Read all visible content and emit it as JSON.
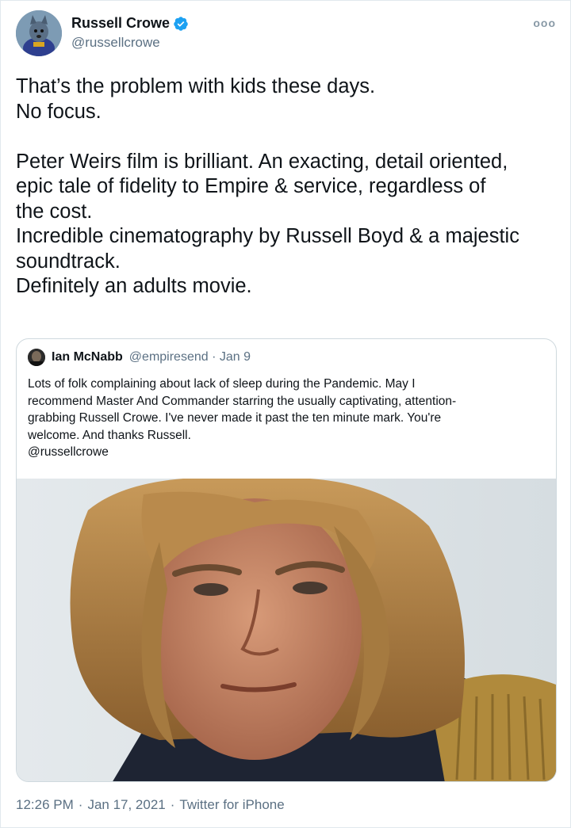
{
  "author": {
    "name": "Russell Crowe",
    "handle": "@russellcrowe",
    "verified": true
  },
  "more_icon": "ooo",
  "tweet_text": {
    "line1": "That’s the problem with kids these days.",
    "line2": "No focus.",
    "line3": "Peter Weirs film is brilliant. An exacting, detail oriented,",
    "line4": "epic tale of fidelity to Empire & service, regardless of",
    "line5": "the cost.",
    "line6": "Incredible cinematography by Russell Boyd & a majestic",
    "line7": "soundtrack.",
    "line8": "Definitely an adults movie."
  },
  "quoted_tweet": {
    "name": "Ian McNabb",
    "handle_date": "@empiresend · Jan 9",
    "line1": "Lots of folk complaining about lack of sleep during the Pandemic. May I",
    "line2": "recommend Master And Commander starring the usually captivating, attention-",
    "line3": "grabbing Russell Crowe. I've never made it past the ten minute mark. You're",
    "line4": "welcome. And thanks Russell.",
    "line5": "@russellcrowe"
  },
  "footer": {
    "time": "12:26 PM",
    "sep1": "·",
    "date": "Jan 17, 2021",
    "sep2": "·",
    "source": "Twitter for iPhone"
  },
  "colors": {
    "verified": "#1da1f2",
    "secondary_text": "#5b7083",
    "border": "#cfd9de"
  }
}
